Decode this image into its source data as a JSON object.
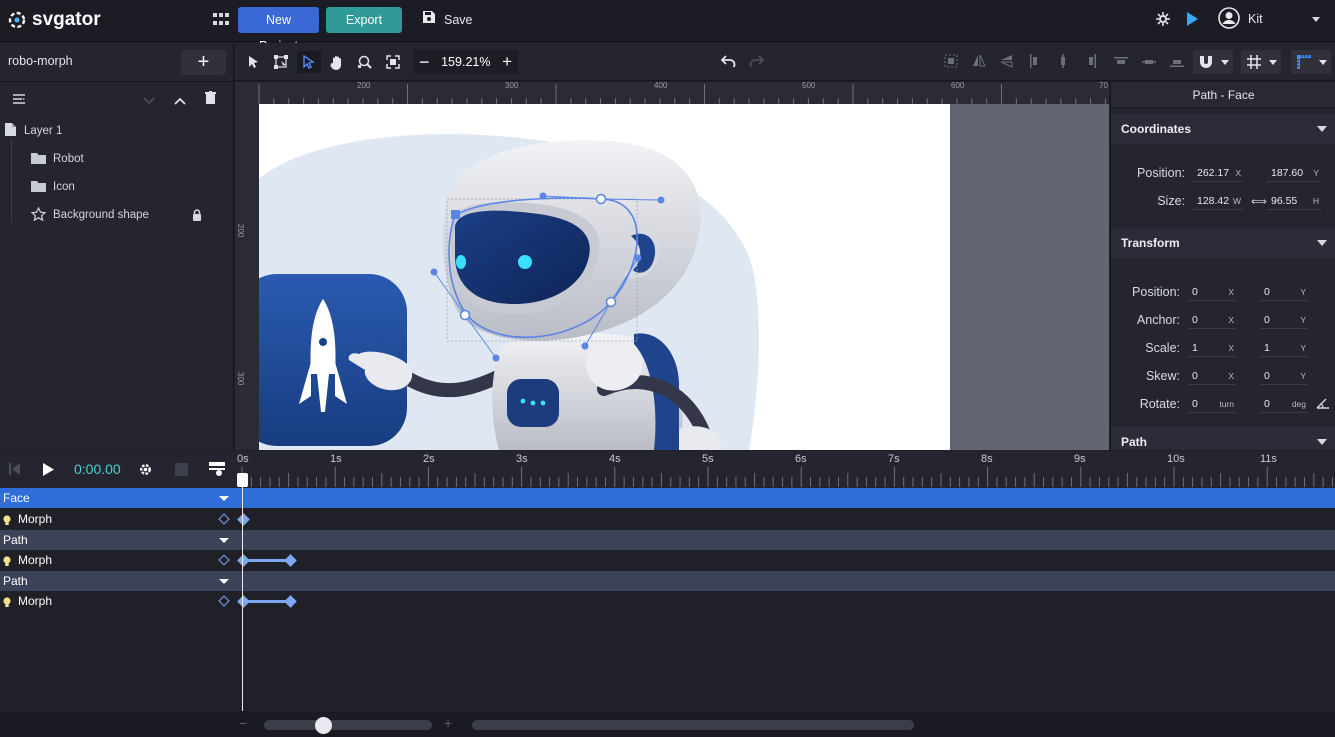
{
  "app": {
    "logo_text": "svgator",
    "new_project_label": "New Project",
    "export_label": "Export",
    "save_label": "Save",
    "user_name": "Kit",
    "accent": "#3a69d6",
    "export_color": "#2f9a97"
  },
  "left_panel": {
    "project_name": "robo-morph",
    "layers": [
      {
        "label": "Layer 1",
        "icon": "file-icon",
        "indent": 0
      },
      {
        "label": "Robot",
        "icon": "folder-icon",
        "indent": 1
      },
      {
        "label": "Icon",
        "icon": "folder-icon",
        "indent": 1
      },
      {
        "label": "Background shape",
        "icon": "star-shape-icon",
        "indent": 1,
        "locked": true
      }
    ]
  },
  "toolbar": {
    "zoom_value": "159.21%"
  },
  "rulers": {
    "top_labels": [
      "200",
      "300",
      "400",
      "500",
      "600",
      "70"
    ],
    "left_labels": [
      "200",
      "300"
    ]
  },
  "right_panel": {
    "title": "Path - Face",
    "coordinates": {
      "header": "Coordinates",
      "position_label": "Position:",
      "position_x": "262.17",
      "position_y": "187.60",
      "size_label": "Size:",
      "size_w": "128.42",
      "size_h": "96.55",
      "unit_x": "X",
      "unit_y": "Y",
      "unit_w": "W",
      "unit_h": "H"
    },
    "transform": {
      "header": "Transform",
      "rows": [
        {
          "label": "Position:",
          "a": "0",
          "ua": "X",
          "b": "0",
          "ub": "Y"
        },
        {
          "label": "Anchor:",
          "a": "0",
          "ua": "X",
          "b": "0",
          "ub": "Y"
        },
        {
          "label": "Scale:",
          "a": "1",
          "ua": "X",
          "b": "1",
          "ub": "Y"
        },
        {
          "label": "Skew:",
          "a": "0",
          "ua": "X",
          "b": "0",
          "ub": "Y"
        },
        {
          "label": "Rotate:",
          "a": "0",
          "ua": "turn",
          "b": "0",
          "ub": "deg"
        }
      ]
    },
    "path_header": "Path"
  },
  "timeline": {
    "time": "0:00.00",
    "ticks": [
      "0s",
      "1s",
      "2s",
      "3s",
      "4s",
      "5s",
      "6s",
      "7s",
      "8s",
      "9s",
      "10s",
      "11s"
    ],
    "rows": [
      {
        "type": "group",
        "label": "Face",
        "selected": true
      },
      {
        "type": "prop",
        "label": "Morph",
        "keys": "single"
      },
      {
        "type": "group",
        "label": "Path",
        "selected": false
      },
      {
        "type": "prop",
        "label": "Morph",
        "keys": "pair"
      },
      {
        "type": "group",
        "label": "Path",
        "selected": false
      },
      {
        "type": "prop",
        "label": "Morph",
        "keys": "pair"
      }
    ]
  }
}
